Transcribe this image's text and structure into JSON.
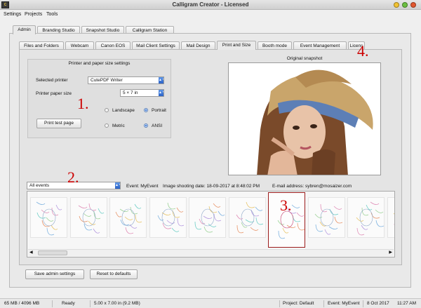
{
  "window": {
    "title": "Calligram Creator - Licensed",
    "icon_text": "C",
    "buttons": {
      "minimize_color": "#f1c232",
      "maximize_color": "#6abf40",
      "close_color": "#e2572f"
    }
  },
  "menu": [
    "Settings",
    "Projects",
    "Tools"
  ],
  "main_tabs": [
    {
      "label": "Admin",
      "active": true
    },
    {
      "label": "Branding Studio",
      "active": false
    },
    {
      "label": "Snapshot Studio",
      "active": false
    },
    {
      "label": "Calligram Station",
      "active": false
    }
  ],
  "sub_tabs": [
    {
      "label": "Files and Folders",
      "active": false
    },
    {
      "label": "Webcam",
      "active": false
    },
    {
      "label": "Canon EOS",
      "active": false
    },
    {
      "label": "Mail Client Settings",
      "active": false
    },
    {
      "label": "Mail Design",
      "active": false
    },
    {
      "label": "Print and Size",
      "active": true
    },
    {
      "label": "Booth mode",
      "active": false
    },
    {
      "label": "Event Management",
      "active": false
    },
    {
      "label": "Licens",
      "active": false
    }
  ],
  "printer_settings": {
    "group_title": "Printer and paper size settings",
    "selected_printer_label": "Selected printer",
    "selected_printer_value": "CutePDF Writer",
    "paper_size_label": "Printer paper size",
    "paper_size_value": "5 × 7 in",
    "orientation": {
      "landscape_label": "Landscape",
      "portrait_label": "Portrait",
      "selected": "Portrait"
    },
    "units": {
      "metric_label": "Metric",
      "ansi_label": "ANSI",
      "selected": "ANSI"
    },
    "test_button": "Print test page"
  },
  "snapshot": {
    "label": "Original snapshot"
  },
  "events": {
    "filter_value": "All events",
    "event_text": "Event: MyEvent",
    "date_text": "Image shooting date:  18-09-2017  at  8:48:02 PM",
    "email_text": "E-mail address:  sybren@mosaizer.com"
  },
  "thumbnails": {
    "count": 10,
    "selected_index": 6
  },
  "annotations": [
    "1.",
    "2.",
    "3.",
    "4."
  ],
  "buttons": {
    "save": "Save admin settings",
    "reset": "Reset to defaults"
  },
  "status": {
    "memory": "65 MB / 4096 MB",
    "state": "Ready",
    "size": "5.00 x 7.00 in  (9.2 MB)",
    "project": "Project: Default",
    "event": "Event: MyEvent",
    "date": "8 Oct 2017",
    "time": "11:27 AM"
  },
  "colors": {
    "annotation": "#cc0000",
    "selection": "#9b1b1b"
  }
}
